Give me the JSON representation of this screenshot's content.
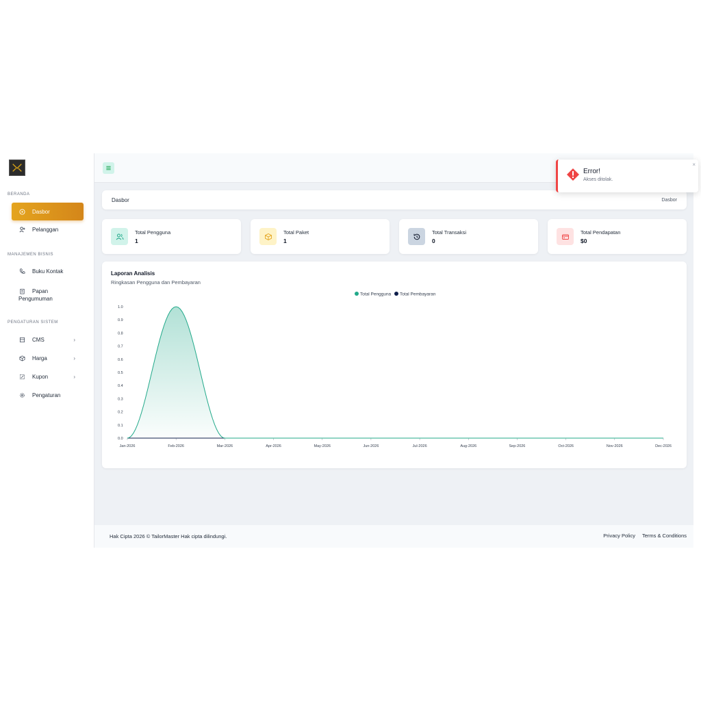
{
  "sidebar": {
    "sections": [
      "BERANDA",
      "MANAJEMEN BISNIS",
      "PENGATURAN SISTEM"
    ],
    "items": [
      {
        "label": "Dasbor",
        "icon": "dashboard-icon"
      },
      {
        "label": "Pelanggan",
        "icon": "user-plus-icon"
      },
      {
        "label": "Buku Kontak",
        "icon": "phone-icon"
      },
      {
        "label_line1": "Papan",
        "label_line2": "Pengumuman",
        "icon": "clipboard-icon"
      },
      {
        "label": "CMS",
        "icon": "layout-icon"
      },
      {
        "label": "Harga",
        "icon": "box-icon"
      },
      {
        "label": "Kupon",
        "icon": "coupon-icon"
      },
      {
        "label": "Pengaturan",
        "icon": "gear-icon"
      }
    ],
    "chevron": "›"
  },
  "breadcrumb": {
    "title": "Dasbor",
    "current": "Dasbor"
  },
  "stats": [
    {
      "label": "Total Pengguna",
      "value": "1",
      "color": "#d1f3ea",
      "icon": "users-icon"
    },
    {
      "label": "Total Paket",
      "value": "1",
      "color": "#fef3c7",
      "icon": "package-icon"
    },
    {
      "label": "Total Transaksi",
      "value": "0",
      "color": "#cbd5e1",
      "icon": "history-icon"
    },
    {
      "label": "Total Pendapatan",
      "value": "$0",
      "color": "#fee2e2",
      "icon": "credit-card-icon"
    }
  ],
  "chart_card": {
    "title": "Laporan Analisis",
    "subtitle": "Ringkasan Pengguna dan Pembayaran"
  },
  "chart_data": {
    "type": "area",
    "categories": [
      "Jan-2026",
      "Feb-2026",
      "Mar-2026",
      "Apr-2026",
      "May-2026",
      "Jun-2026",
      "Jul-2026",
      "Aug-2026",
      "Sep-2026",
      "Oct-2026",
      "Nov-2026",
      "Dec-2026"
    ],
    "series": [
      {
        "name": "Total Pengguna",
        "values": [
          0,
          1,
          0,
          0,
          0,
          0,
          0,
          0,
          0,
          0,
          0,
          0
        ],
        "color": "#22a98a"
      },
      {
        "name": "Total Pembayaran",
        "values": [
          0,
          0,
          0,
          0,
          0,
          0,
          0,
          0,
          0,
          0,
          0,
          0
        ],
        "color": "#0f1f4b"
      }
    ],
    "yticks": [
      "0.0",
      "0.1",
      "0.2",
      "0.3",
      "0.4",
      "0.5",
      "0.6",
      "0.7",
      "0.8",
      "0.9",
      "1.0"
    ],
    "ylim": [
      0,
      1
    ],
    "legend": "top-center",
    "grid": false
  },
  "footer": {
    "copyright": "Hak Cipta 2026 © TailorMaster Hak cipta dilindungi.",
    "links": [
      "Privacy Policy",
      "Terms & Conditions"
    ]
  },
  "toast": {
    "title": "Error!",
    "message": "Akses ditolak.",
    "close": "×",
    "accent": "#ef4444"
  }
}
